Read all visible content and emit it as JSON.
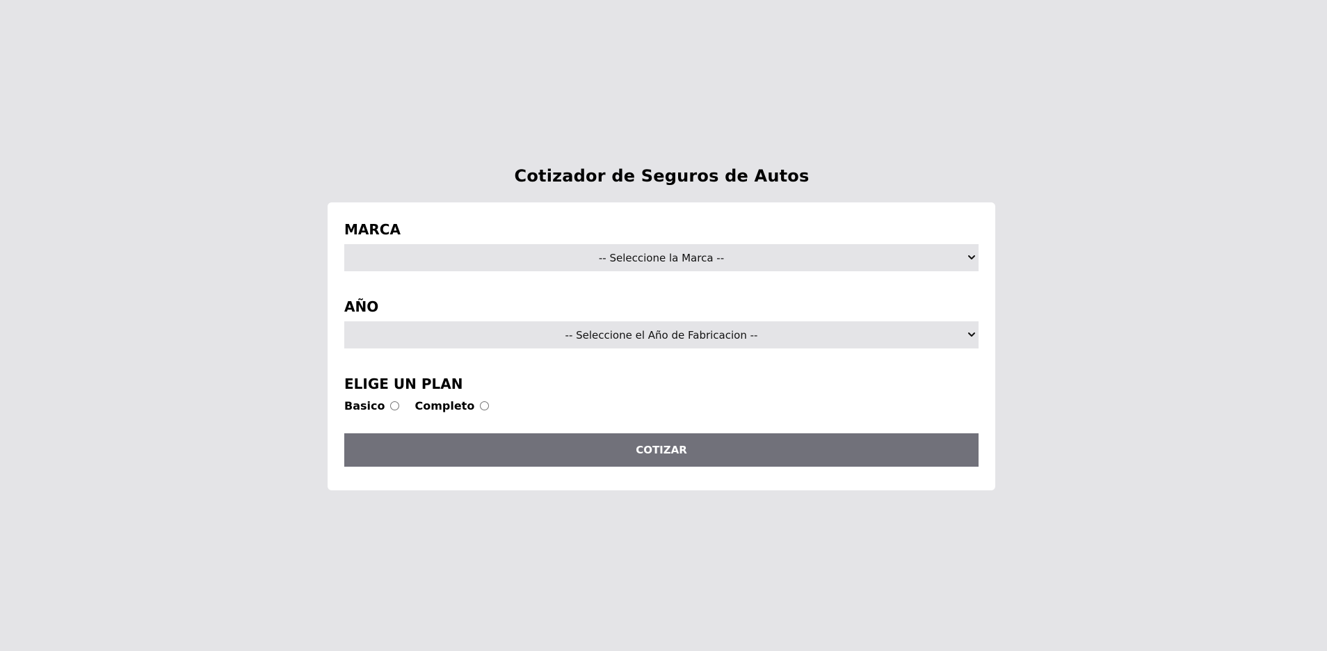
{
  "page": {
    "title": "Cotizador de Seguros de Autos"
  },
  "form": {
    "marca": {
      "label": "MARCA",
      "placeholder_option": "-- Seleccione la Marca --"
    },
    "anio": {
      "label": "AÑO",
      "placeholder_option": "-- Seleccione el Año de Fabricacion --"
    },
    "plan": {
      "label": "ELIGE UN PLAN",
      "options": [
        {
          "label": "Basico",
          "value": "basico",
          "checked": false
        },
        {
          "label": "Completo",
          "value": "completo",
          "checked": false
        }
      ]
    },
    "submit_label": "COTIZAR"
  },
  "colors": {
    "background": "#e4e4e7",
    "card": "#ffffff",
    "select_bg": "#e4e4e7",
    "button_bg": "#71717a",
    "button_text": "#ffffff"
  },
  "icons": {
    "select_arrow": "chevron-down-icon"
  }
}
